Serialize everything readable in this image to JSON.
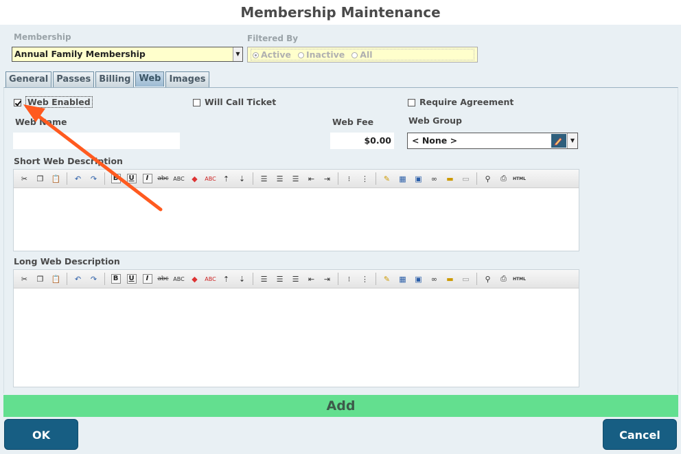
{
  "window": {
    "title": "Membership Maintenance"
  },
  "membership": {
    "label": "Membership",
    "selected": "Annual Family Membership"
  },
  "filter": {
    "label": "Filtered By",
    "options": [
      "Active",
      "Inactive",
      "All"
    ],
    "selected": "Active"
  },
  "tabs": [
    {
      "label": "General"
    },
    {
      "label": "Passes"
    },
    {
      "label": "Billing"
    },
    {
      "label": "Web",
      "active": true
    },
    {
      "label": "Images"
    }
  ],
  "web": {
    "web_enabled_label": "Web Enabled",
    "web_enabled_checked": true,
    "will_call_label": "Will Call Ticket",
    "will_call_checked": false,
    "require_agreement_label": "Require Agreement",
    "require_agreement_checked": false,
    "web_name_label": "Web Name",
    "web_name_value": "",
    "web_fee_label": "Web Fee",
    "web_fee_value": "$0.00",
    "web_group_label": "Web Group",
    "web_group_value": "< None >",
    "short_desc_label": "Short Web Description",
    "long_desc_label": "Long Web Description"
  },
  "toolbar_icons": [
    "cut-icon",
    "copy-icon",
    "paste-icon",
    "undo-icon",
    "redo-icon",
    "bold-icon",
    "underline-icon",
    "italic-icon",
    "strikethrough-icon",
    "spellcheck-icon",
    "eraser-icon",
    "text-color-icon",
    "sort-ascending-icon",
    "sort-descending-icon",
    "align-left-icon",
    "align-center-icon",
    "align-right-icon",
    "outdent-icon",
    "indent-icon",
    "bulleted-list-icon",
    "numbered-list-icon",
    "edit-icon",
    "table-icon",
    "image-icon",
    "link-icon",
    "media-icon",
    "placeholder-icon",
    "find-icon",
    "print-icon",
    "html-icon"
  ],
  "toolbar_glyphs": {
    "strike": "abc",
    "spell": "ABC",
    "textcolor": "ABC",
    "html": "HTML"
  },
  "actions": {
    "add_label": "Add",
    "ok_label": "OK",
    "cancel_label": "Cancel"
  },
  "colors": {
    "accent_button": "#175e83",
    "add_bar": "#63df8f",
    "input_highlight": "#ffffcc",
    "annotation_arrow": "#ff5a1f"
  }
}
